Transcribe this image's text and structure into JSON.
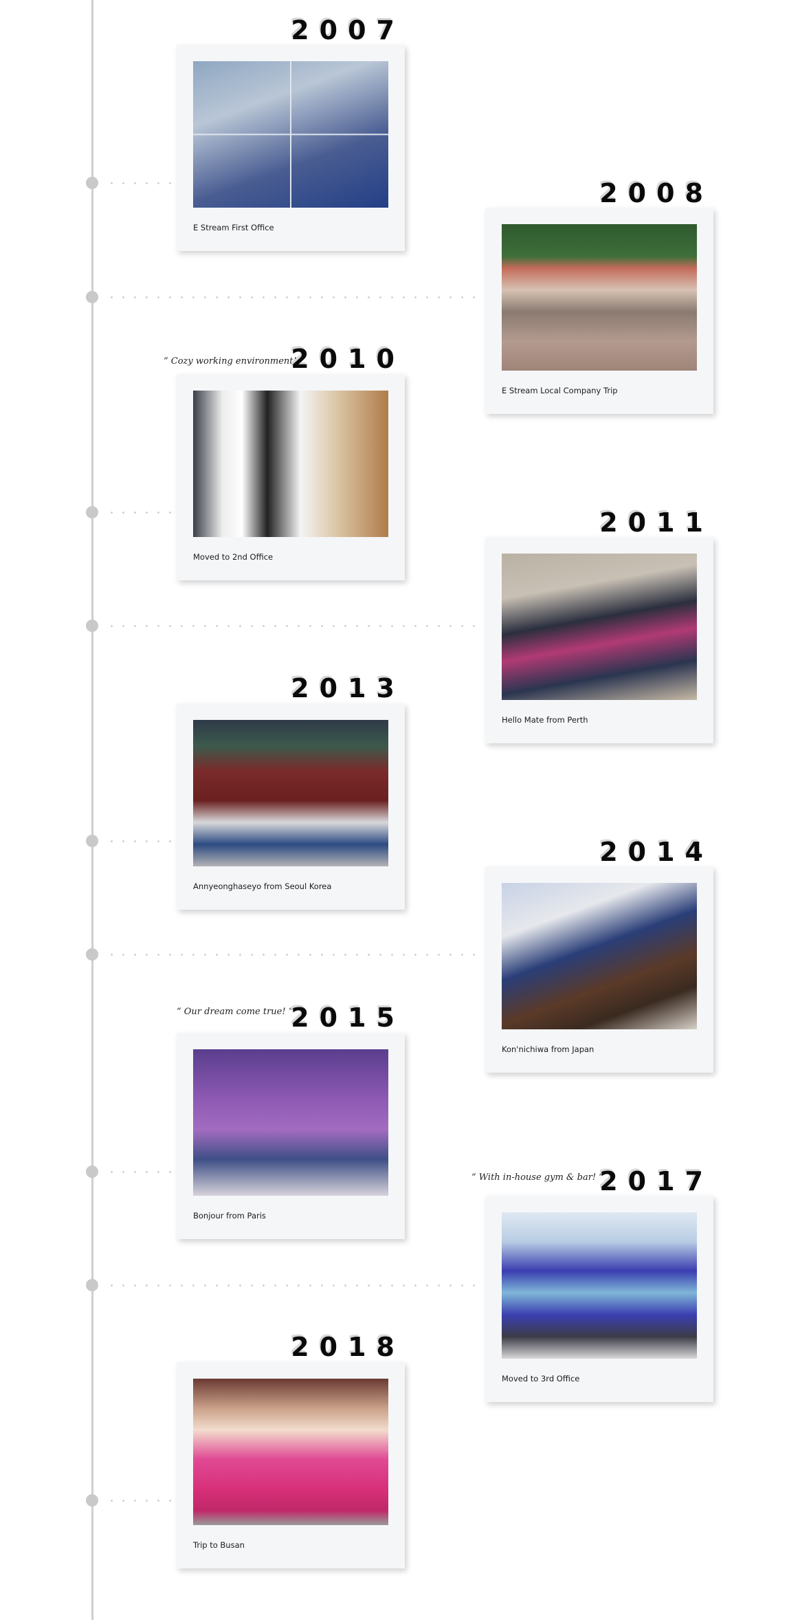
{
  "timeline": {
    "items": [
      {
        "year": "2007",
        "caption": "E Stream First Office",
        "quote": null,
        "side": "left",
        "photo": "office-group-collage"
      },
      {
        "year": "2008",
        "caption": "E Stream Local Company Trip",
        "quote": null,
        "side": "right",
        "photo": "company-trip-group"
      },
      {
        "year": "2010",
        "caption": "Moved to 2nd Office",
        "quote": "“ Cozy working environment! ”",
        "side": "left",
        "photo": "second-office-interior"
      },
      {
        "year": "2011",
        "caption": "Hello Mate from Perth",
        "quote": null,
        "side": "right",
        "photo": "perth-beach-group"
      },
      {
        "year": "2013",
        "caption": "Annyeonghaseyo from Seoul Korea",
        "quote": null,
        "side": "left",
        "photo": "seoul-palace-group"
      },
      {
        "year": "2014",
        "caption": "Kon'nichiwa from Japan",
        "quote": null,
        "side": "right",
        "photo": "japan-dinner-group"
      },
      {
        "year": "2015",
        "caption": "Bonjour from Paris",
        "quote": "“ Our dream come true! ”",
        "side": "left",
        "photo": "paris-eiffel-group"
      },
      {
        "year": "2017",
        "caption": "Moved to 3rd Office",
        "quote": "“ With in-house gym & bar! ”",
        "side": "right",
        "photo": "third-office-building"
      },
      {
        "year": "2018",
        "caption": "Trip to Busan",
        "quote": null,
        "side": "left",
        "photo": "busan-hanbok-group"
      }
    ]
  },
  "colors": {
    "timeline_line": "#cfcfcf",
    "card_background": "#f5f6f8",
    "year_text": "#0a0a0a"
  }
}
